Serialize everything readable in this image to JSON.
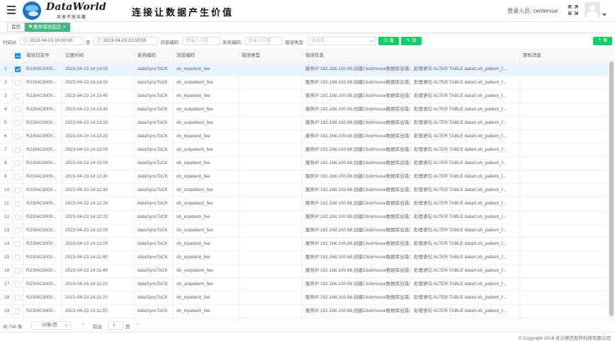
{
  "header": {
    "logo_text": "DataWorld",
    "logo_sub": "共享开放共赢",
    "slogan": "连接让数据产生价值",
    "login_label": "登录人员: centervue"
  },
  "tags": [
    {
      "label": "首页",
      "active": false
    },
    {
      "label": "服务错误监控",
      "active": true,
      "close": "×"
    }
  ],
  "filter": {
    "time_label": "时间从",
    "start_time": "2023-04-23 00:00:00",
    "to_label": "至",
    "end_time": "2023-04-23 23:59:59",
    "msg_code_label": "消息编码",
    "msg_code_placeholder": "请输入内容",
    "sys_code_label": "系统编码",
    "sys_code_placeholder": "请输入内容",
    "err_type_label": "错误类型",
    "err_type_placeholder": "请选择",
    "query_label": "查询",
    "browse_label": "浏览",
    "export_label": "导出"
  },
  "table": {
    "columns": [
      "",
      "错误日志号",
      "记录时间",
      "系统编码",
      "消息编码",
      "错误类型",
      "错误信息",
      "原始消息"
    ],
    "rows": [
      {
        "no": "1",
        "id": "R230423000...",
        "time": "2023-04-23 14:14:00",
        "sys": "dataSyncToCK",
        "msg": "vb_inpatient_fee",
        "type": "",
        "info": "服务IP:192.168.100.98,创建ClickHouse数据库出错：处理语句:ALTER TABLE datart.vb_patient_f...",
        "raw": "",
        "checked": true
      },
      {
        "no": "2",
        "id": "R230423000...",
        "time": "2023-04-23 14:14:00",
        "sys": "dataSyncToCK",
        "msg": "vb_outpatient_fee",
        "type": "",
        "info": "服务IP:192.168.100.98,创建ClickHouse数据库出错：处理语句:ALTER TABLE datart.vb_patient_f...",
        "raw": "",
        "checked": false
      },
      {
        "no": "3",
        "id": "R230423000...",
        "time": "2023-04-23 14:13:40",
        "sys": "dataSyncToCK",
        "msg": "vb_inpatient_fee",
        "type": "",
        "info": "服务IP:192.168.100.98,创建ClickHouse数据库出错：处理语句:ALTER TABLE datart.vb_patient_f...",
        "raw": "",
        "checked": false
      },
      {
        "no": "4",
        "id": "R230423000...",
        "time": "2023-04-23 14:13:40",
        "sys": "dataSyncToCK",
        "msg": "vb_outpatient_fee",
        "type": "",
        "info": "服务IP:192.168.100.98,创建ClickHouse数据库出错：处理语句:ALTER TABLE datart.vb_patient_f...",
        "raw": "",
        "checked": false
      },
      {
        "no": "5",
        "id": "R230423000...",
        "time": "2023-04-23 14:13:20",
        "sys": "dataSyncToCK",
        "msg": "vb_outpatient_fee",
        "type": "",
        "info": "服务IP:192.168.100.98,创建ClickHouse数据库出错：处理语句:ALTER TABLE datart.vb_patient_f...",
        "raw": "",
        "checked": false
      },
      {
        "no": "6",
        "id": "R230423000...",
        "time": "2023-04-23 14:13:20",
        "sys": "dataSyncToCK",
        "msg": "vb_inpatient_fee",
        "type": "",
        "info": "服务IP:192.168.100.98,创建ClickHouse数据库出错：处理语句:ALTER TABLE datart.vb_patient_f...",
        "raw": "",
        "checked": false
      },
      {
        "no": "7",
        "id": "R230423000...",
        "time": "2023-04-23 14:13:00",
        "sys": "dataSyncToCK",
        "msg": "vb_outpatient_fee",
        "type": "",
        "info": "服务IP:192.168.100.98,创建ClickHouse数据库出错：处理语句:ALTER TABLE datart.vb_patient_f...",
        "raw": "",
        "checked": false
      },
      {
        "no": "8",
        "id": "R230423000...",
        "time": "2023-04-23 14:13:00",
        "sys": "dataSyncToCK",
        "msg": "vb_inpatient_fee",
        "type": "",
        "info": "服务IP:192.168.100.98,创建ClickHouse数据库出错：处理语句:ALTER TABLE datart.vb_patient_f...",
        "raw": "",
        "checked": false
      },
      {
        "no": "9",
        "id": "R230423000...",
        "time": "2023-04-23 14:12:40",
        "sys": "dataSyncToCK",
        "msg": "vb_inpatient_fee",
        "type": "",
        "info": "服务IP:192.168.100.98,创建ClickHouse数据库出错：处理语句:ALTER TABLE datart.vb_patient_f...",
        "raw": "",
        "checked": false
      },
      {
        "no": "10",
        "id": "R230423000...",
        "time": "2023-04-23 14:12:40",
        "sys": "dataSyncToCK",
        "msg": "vb_outpatient_fee",
        "type": "",
        "info": "服务IP:192.168.100.98,创建ClickHouse数据库出错：处理语句:ALTER TABLE datart.vb_patient_f...",
        "raw": "",
        "checked": false
      },
      {
        "no": "11",
        "id": "R230423000...",
        "time": "2023-04-23 14:12:20",
        "sys": "dataSyncToCK",
        "msg": "vb_outpatient_fee",
        "type": "",
        "info": "服务IP:192.168.100.98,创建ClickHouse数据库出错：处理语句:ALTER TABLE datart.vb_patient_f...",
        "raw": "",
        "checked": false
      },
      {
        "no": "12",
        "id": "R230423000...",
        "time": "2023-04-23 14:12:20",
        "sys": "dataSyncToCK",
        "msg": "vb_inpatient_fee",
        "type": "",
        "info": "服务IP:192.168.100.98,创建ClickHouse数据库出错：处理语句:ALTER TABLE datart.vb_patient_f...",
        "raw": "",
        "checked": false
      },
      {
        "no": "13",
        "id": "R230423000...",
        "time": "2023-04-23 14:12:00",
        "sys": "dataSyncToCK",
        "msg": "vb_outpatient_fee",
        "type": "",
        "info": "服务IP:192.168.100.98,创建ClickHouse数据库出错：处理语句:ALTER TABLE datart.vb_patient_f...",
        "raw": "",
        "checked": false
      },
      {
        "no": "14",
        "id": "R230423000...",
        "time": "2023-04-23 14:12:00",
        "sys": "dataSyncToCK",
        "msg": "vb_inpatient_fee",
        "type": "",
        "info": "服务IP:192.168.100.98,创建ClickHouse数据库出错：处理语句:ALTER TABLE datart.vb_patient_f...",
        "raw": "",
        "checked": false
      },
      {
        "no": "15",
        "id": "R230423000...",
        "time": "2023-04-23 14:11:40",
        "sys": "dataSyncToCK",
        "msg": "vb_inpatient_fee",
        "type": "",
        "info": "服务IP:192.168.100.98,创建ClickHouse数据库出错：处理语句:ALTER TABLE datart.vb_patient_f...",
        "raw": "",
        "checked": false
      },
      {
        "no": "16",
        "id": "R230423000...",
        "time": "2023-04-23 14:11:40",
        "sys": "dataSyncToCK",
        "msg": "vb_outpatient_fee",
        "type": "",
        "info": "服务IP:192.168.100.98,创建ClickHouse数据库出错：处理语句:ALTER TABLE datart.vb_patient_f...",
        "raw": "",
        "checked": false
      },
      {
        "no": "17",
        "id": "R230423000...",
        "time": "2023-04-23 14:11:20",
        "sys": "dataSyncToCK",
        "msg": "vb_outpatient_fee",
        "type": "",
        "info": "服务IP:192.168.100.98,创建ClickHouse数据库出错：处理语句:ALTER TABLE datart.vb_patient_f...",
        "raw": "",
        "checked": false
      },
      {
        "no": "18",
        "id": "R230423000...",
        "time": "2023-04-23 14:11:20",
        "sys": "dataSyncToCK",
        "msg": "vb_inpatient_fee",
        "type": "",
        "info": "服务IP:192.168.100.98,创建ClickHouse数据库出错：处理语句:ALTER TABLE datart.vb_patient_f...",
        "raw": "",
        "checked": false
      },
      {
        "no": "19",
        "id": "R230423000...",
        "time": "2023-04-23 14:11:00",
        "sys": "dataSyncToCK",
        "msg": "vb_inpatient_fee",
        "type": "",
        "info": "服务IP:192.168.100.98,创建ClickHouse数据库出错：处理语句:ALTER TABLE datart.vb_patient_f...",
        "raw": "",
        "checked": false
      },
      {
        "no": "20",
        "id": "R230423000...",
        "time": "2023-04-23 14:11:00",
        "sys": "dataSyncToCK",
        "msg": "vb_outpatient_fee",
        "type": "",
        "info": "服务IP:192.168.100.98,创建ClickHouse数据库出错：处理语句:ALTER TABLE datart.vb_patient_f...",
        "raw": "",
        "checked": false
      }
    ]
  },
  "pager": {
    "total": "共 746 条",
    "page_size": "20条/页",
    "prev": "‹",
    "goto": "前往",
    "page": "1",
    "page_unit": "页",
    "next": "›"
  },
  "footer": {
    "copyright": "© Copyright 2016 长沙廖氏软件科技有限公司"
  },
  "colors": {
    "primary": "#1890ff",
    "success": "#13ce66",
    "tag_active": "#42b983",
    "selected_row": "#e8f4ff"
  }
}
